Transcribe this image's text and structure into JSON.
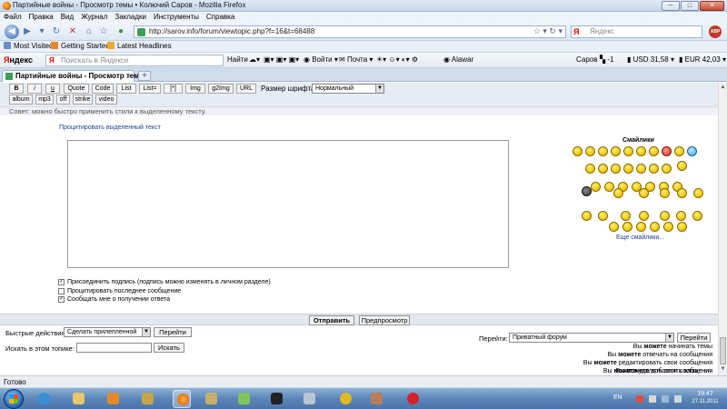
{
  "window": {
    "title": "Партийные войны - Просмотр темы • Колючий Саров - Mozilla Firefox",
    "min": "─",
    "max": "□",
    "close": "✕"
  },
  "menu": [
    "Файл",
    "Правка",
    "Вид",
    "Журнал",
    "Закладки",
    "Инструменты",
    "Справка"
  ],
  "nav": {
    "url": "http://sarov.info/forum/viewtopic.php?f=16&t=68488",
    "search_placeholder": "Яндекс",
    "search_logo": "Я",
    "abp": "ABP"
  },
  "bookmarks": [
    "Most Visited",
    "Getting Started",
    "Latest Headlines"
  ],
  "yandex_bar": {
    "logo": "Яндекс",
    "logo_first": "Я",
    "logo_rest": "ндекс",
    "search_logo": "Я",
    "search_placeholder": "Поискать в Яндексе",
    "find": "Найти",
    "weather_city": "Погода",
    "mail": "Почта",
    "enter": "Войти",
    "alawar": "Alawar",
    "city": "Саров",
    "temp": "-1",
    "usd": "USD 31,58",
    "eur": "EUR 42,03"
  },
  "tab": {
    "label": "Партийные войны - Просмотр тем...",
    "close": "×",
    "new": "+"
  },
  "editor": {
    "buttons_row1": [
      "B",
      "i",
      "u",
      "Quote",
      "Code",
      "List",
      "List=",
      "[*]",
      "Img",
      "g2Img",
      "URL"
    ],
    "buttons_row2": [
      "album",
      "mp3",
      "off",
      "strike",
      "video"
    ],
    "font_size_label": "Размер шрифта:",
    "font_size_value": "Нормальный",
    "hint": "Совет: можно быстро применить стили к выделенному тексту.",
    "quote_selected": "Процитировать выделенный текст",
    "message": ""
  },
  "smilies": {
    "title": "Смайлики",
    "more": "Еще смайлики..."
  },
  "options": [
    {
      "label": "Присоединить подпись (подпись можно изменять в личном разделе)",
      "checked": true
    },
    {
      "label": "Процитировать последнее сообщение",
      "checked": false
    },
    {
      "label": "Сообщать мне о получении ответа",
      "checked": true
    }
  ],
  "submit": {
    "send": "Отправить",
    "preview": "Предпросмотр"
  },
  "quick_actions": {
    "label": "Быстрые действия:",
    "value": "Сделать прилепленной",
    "go": "Перейти"
  },
  "topic_search": {
    "label": "Искать в этом топике:",
    "value": "",
    "button": "Искать"
  },
  "jump": {
    "label": "Перейти:",
    "value": "Приватный форум",
    "go": "Перейти"
  },
  "permissions": [
    [
      "Вы ",
      "можете",
      " начинать темы"
    ],
    [
      "Вы ",
      "можете",
      " отвечать на сообщения"
    ],
    [
      "Вы ",
      "можете",
      " редактировать свои сообщения"
    ],
    [
      "Вы ",
      "можете",
      " удалять свои сообщения"
    ],
    [
      "Вы ",
      "можете",
      " добавлять вложения"
    ]
  ],
  "status": "Готово",
  "taskbar": {
    "lang": "EN",
    "time": "19:47",
    "date": "27.11.2011"
  }
}
